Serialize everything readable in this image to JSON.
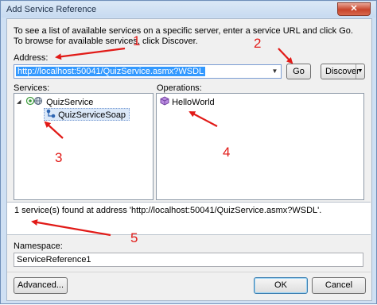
{
  "window": {
    "title": "Add Service Reference",
    "close_glyph": "✕"
  },
  "intro_text": "To see a list of available services on a specific server, enter a service URL and click Go. To browse for available services, click Discover.",
  "address": {
    "label": "Address:",
    "value": "http://localhost:50041/QuizService.asmx?WSDL",
    "go_label": "Go",
    "discover_label": "Discover"
  },
  "services": {
    "label": "Services:",
    "items": [
      {
        "label": "QuizService",
        "icon": "web-service-icon"
      },
      {
        "label": "QuizServiceSoap",
        "icon": "service-contract-icon"
      }
    ]
  },
  "operations": {
    "label": "Operations:",
    "items": [
      {
        "label": "HelloWorld",
        "icon": "operation-icon"
      }
    ]
  },
  "status_text": "1 service(s) found at address 'http://localhost:50041/QuizService.asmx?WSDL'.",
  "namespace": {
    "label": "Namespace:",
    "value": "ServiceReference1"
  },
  "buttons": {
    "advanced": "Advanced...",
    "ok": "OK",
    "cancel": "Cancel"
  },
  "annotations": [
    "1",
    "2",
    "3",
    "4",
    "5"
  ],
  "colors": {
    "annotation": "#e11a17",
    "selection": "#3399ff",
    "dialog_bg": "#f0f0f0"
  }
}
